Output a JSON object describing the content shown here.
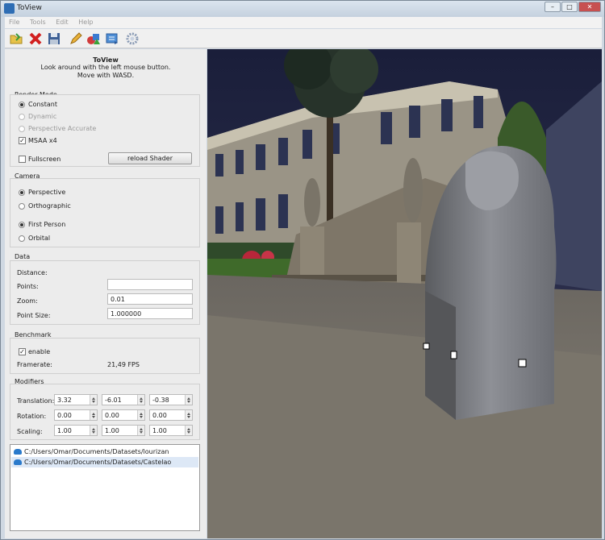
{
  "window": {
    "title": "ToView",
    "min": "–",
    "max": "□",
    "close": "✕"
  },
  "menu": [
    "File",
    "Tools",
    "Edit",
    "Help"
  ],
  "toolbar": {
    "icons": [
      "open-folder-icon",
      "delete-x-icon",
      "save-disk-icon",
      "pencil-icon",
      "shapes-icon",
      "export-icon",
      "settings-gear-icon"
    ]
  },
  "header": {
    "title": "ToView",
    "line1": "Look around with the left mouse button.",
    "line2": "Move with WASD."
  },
  "render_mode": {
    "label": "Render Mode",
    "options": [
      "Constant",
      "Dynamic",
      "Perspective Accurate"
    ],
    "selected": "Constant",
    "msaa_label": "MSAA x4",
    "msaa_checked": true,
    "fullscreen_label": "Fullscreen",
    "fullscreen_checked": false,
    "reload_label": "reload Shader"
  },
  "camera": {
    "label": "Camera",
    "projection": [
      "Perspective",
      "Orthographic"
    ],
    "projection_selected": "Perspective",
    "mode": [
      "First Person",
      "Orbital"
    ],
    "mode_selected": "First Person"
  },
  "data": {
    "label": "Data",
    "distance_label": "Distance:",
    "points_label": "Points:",
    "points_value": "",
    "zoom_label": "Zoom:",
    "zoom_value": "0.01",
    "pointsize_label": "Point Size:",
    "pointsize_value": "1.000000"
  },
  "benchmark": {
    "label": "Benchmark",
    "enable_label": "enable",
    "enable_checked": true,
    "framerate_label": "Framerate:",
    "framerate_value": "21,49 FPS"
  },
  "modifiers": {
    "label": "Modifiers",
    "translation_label": "Translation:",
    "translation": [
      "3.32",
      "-6.01",
      "-0.38"
    ],
    "rotation_label": "Rotation:",
    "rotation": [
      "0.00",
      "0.00",
      "0.00"
    ],
    "scaling_label": "Scaling:",
    "scaling": [
      "1.00",
      "1.00",
      "1.00"
    ]
  },
  "datasets": [
    {
      "path": "C:/Users/Omar/Documents/Datasets/lourizan",
      "selected": false
    },
    {
      "path": "C:/Users/Omar/Documents/Datasets/Castelao",
      "selected": true
    }
  ]
}
